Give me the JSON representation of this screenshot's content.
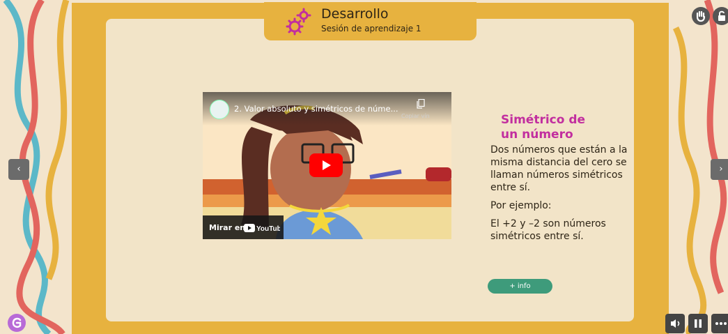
{
  "header": {
    "title": "Desarrollo",
    "subtitle": "Sesión de aprendizaje 1",
    "icon": "gears-icon"
  },
  "video": {
    "title": "2. Valor absoluto y simétricos de núme...",
    "copy_label": "Copiar vín",
    "watch_label": "Mirar en",
    "platform_label": "YouTube"
  },
  "info": {
    "title": "Simétrico de un número",
    "paragraphs": [
      "Dos números que están a la misma distancia del cero se llaman números simétricos entre sí.",
      "Por ejemplo:",
      "El +2 y –2 son números simétricos entre sí."
    ],
    "button_label": "+ info"
  },
  "nav": {
    "prev_label": "‹",
    "next_label": "›"
  },
  "controls": {
    "icons": [
      "hand-icon",
      "lock-icon",
      "volume-icon",
      "pause-icon",
      "more-icon"
    ]
  },
  "colors": {
    "frame": "#e7b23f",
    "card": "#f2e4c8",
    "title_accent": "#c22e9f",
    "button": "#3e9b7b"
  }
}
